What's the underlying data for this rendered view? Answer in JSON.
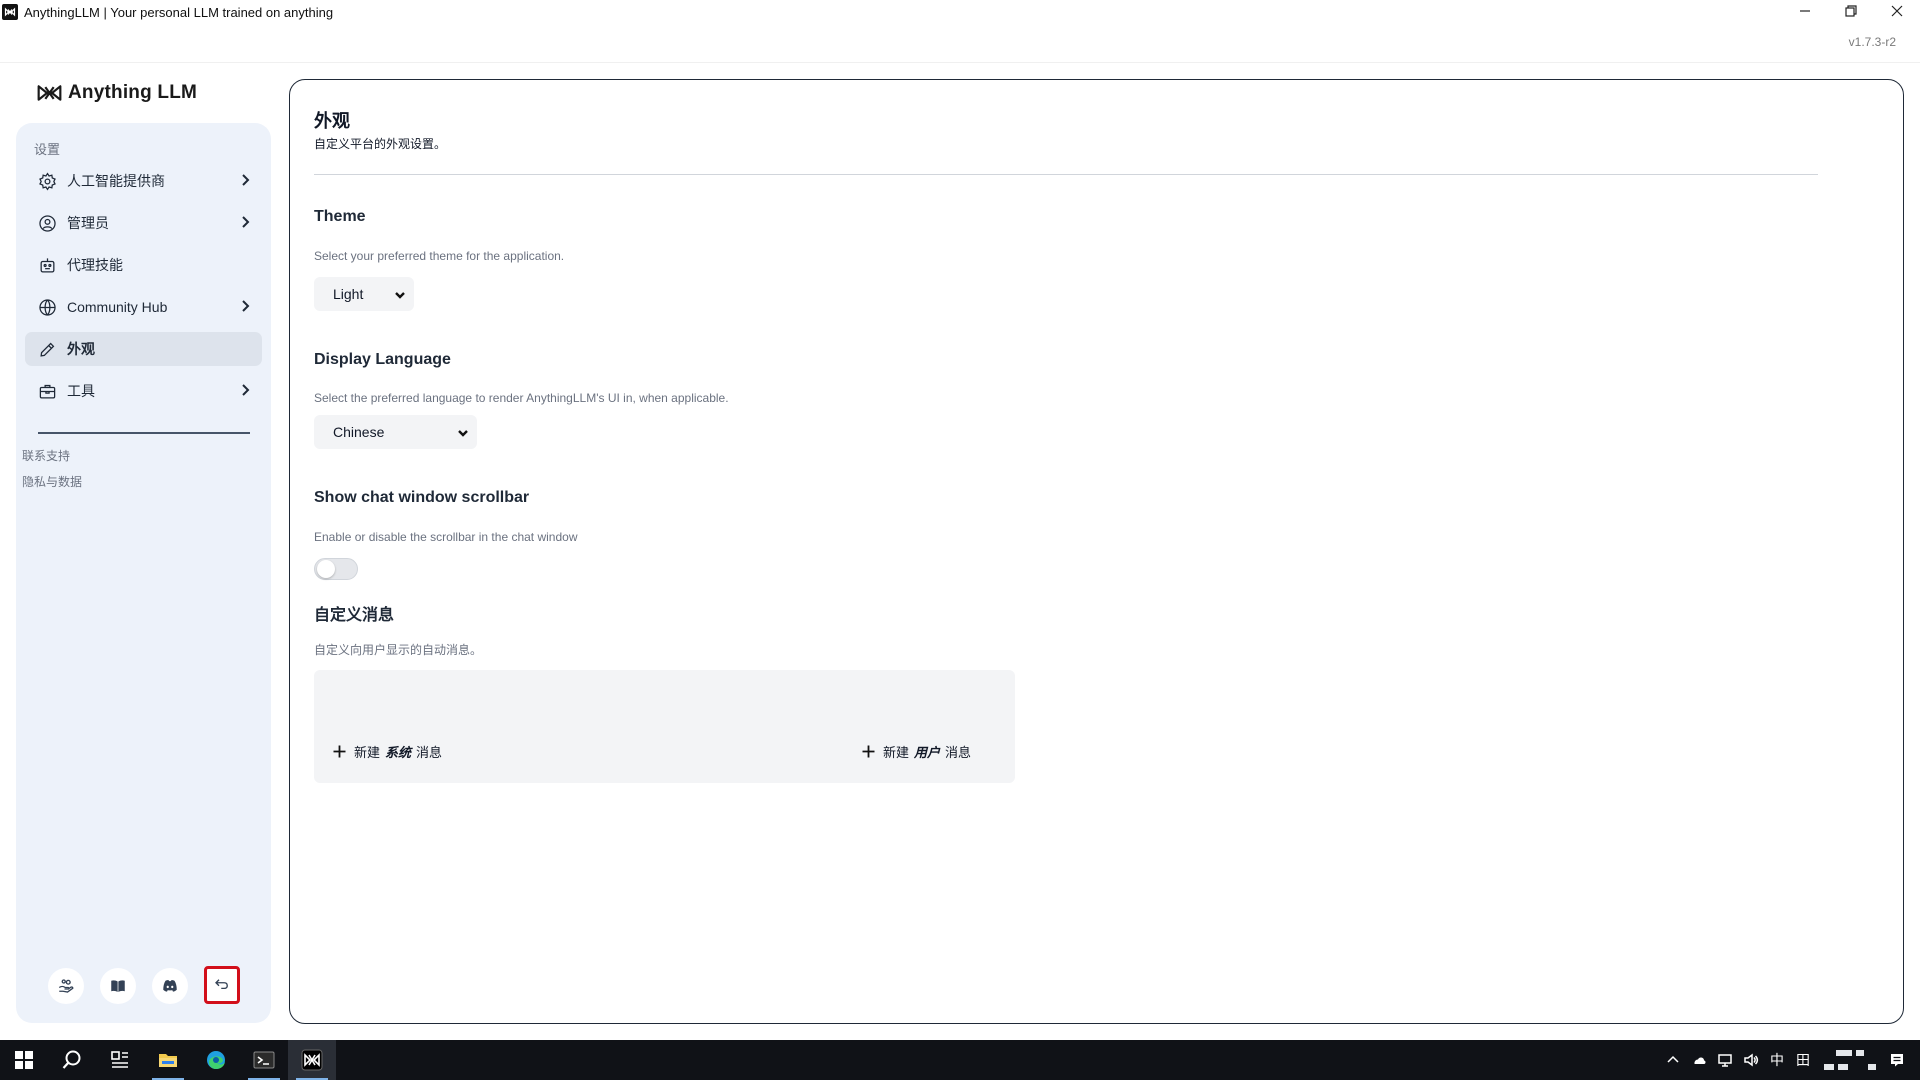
{
  "window": {
    "title": "AnythingLLM | Your personal LLM trained on anything",
    "version": "v1.7.3-r2"
  },
  "brand": {
    "name": "Anything LLM"
  },
  "sidebar": {
    "section_title": "设置",
    "items": [
      {
        "label": "人工智能提供商",
        "icon": "gear-icon",
        "has_submenu": true,
        "active": false
      },
      {
        "label": "管理员",
        "icon": "user-gear-icon",
        "has_submenu": true,
        "active": false
      },
      {
        "label": "代理技能",
        "icon": "robot-icon",
        "has_submenu": false,
        "active": false
      },
      {
        "label": "Community Hub",
        "icon": "globe-icon",
        "has_submenu": true,
        "active": false
      },
      {
        "label": "外观",
        "icon": "pencil-icon",
        "has_submenu": false,
        "active": true
      },
      {
        "label": "工具",
        "icon": "toolbox-icon",
        "has_submenu": true,
        "active": false
      }
    ],
    "links": [
      "联系支持",
      "隐私与数据"
    ],
    "footer_buttons": [
      {
        "icon": "community-hands-icon"
      },
      {
        "icon": "book-icon"
      },
      {
        "icon": "discord-icon"
      },
      {
        "icon": "back-arrow-icon",
        "highlighted": true
      }
    ]
  },
  "main": {
    "title": "外观",
    "description": "自定义平台的外观设置。",
    "theme": {
      "title": "Theme",
      "description": "Select your preferred theme for the application.",
      "selected": "Light"
    },
    "language": {
      "title": "Display Language",
      "description": "Select the preferred language to render AnythingLLM's UI in, when applicable.",
      "selected": "Chinese"
    },
    "scrollbar": {
      "title": "Show chat window scrollbar",
      "description": "Enable or disable the scrollbar in the chat window",
      "enabled": false
    },
    "custom_messages": {
      "title": "自定义消息",
      "description": "自定义向用户显示的自动消息。",
      "new_system": {
        "prefix": "新建",
        "emphasis": "系统",
        "suffix": "消息"
      },
      "new_user": {
        "prefix": "新建",
        "emphasis": "用户",
        "suffix": "消息"
      }
    }
  },
  "taskbar": {
    "items": [
      "windows-start-icon",
      "search-icon",
      "task-view-icon",
      "file-explorer-icon",
      "edge-icon",
      "terminal-icon",
      "anythingllm-icon"
    ],
    "tray_ime": "中",
    "tray_grid": "田"
  },
  "colors": {
    "sidebar_bg": "#edf2fa",
    "active_item_bg": "#dde3ec",
    "highlight_border": "#d20f1a",
    "taskbar_bg": "#101217"
  }
}
